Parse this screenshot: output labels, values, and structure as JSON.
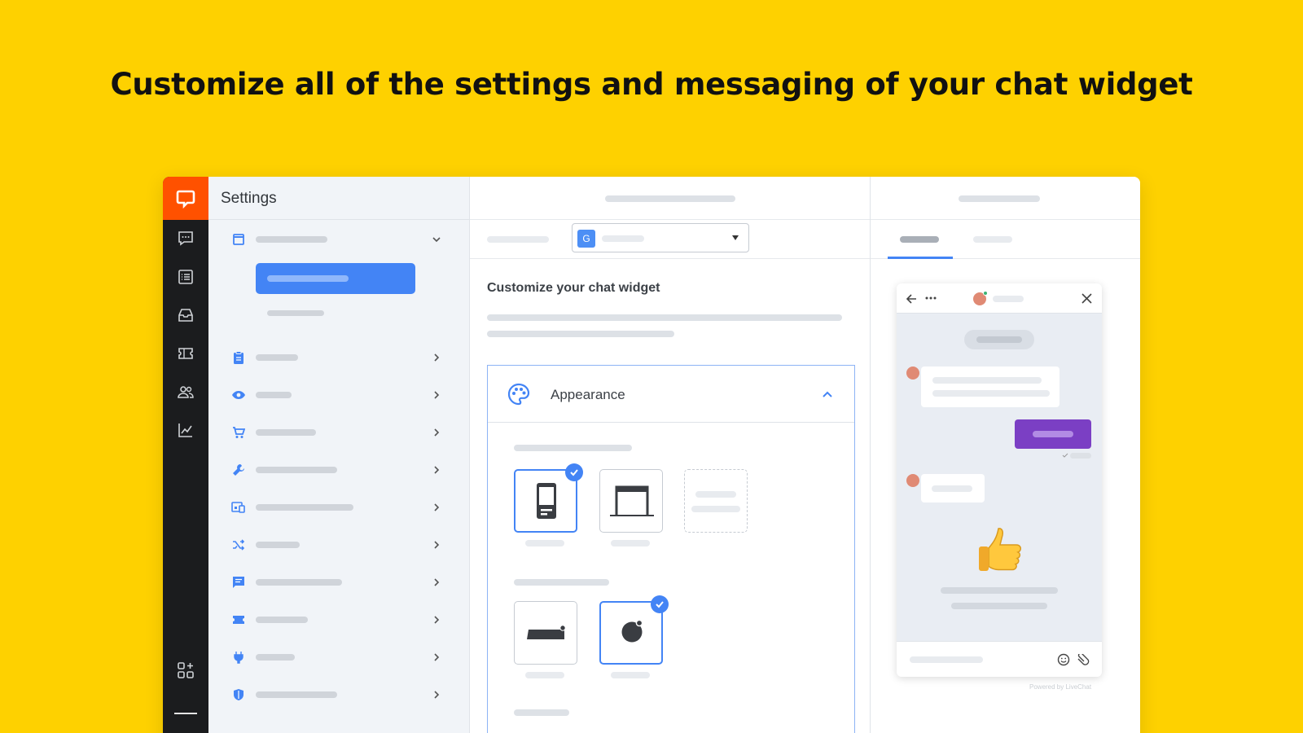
{
  "headline": "Customize all of the settings and messaging of your chat widget",
  "settings": {
    "title": "Settings"
  },
  "middle": {
    "title": "Customize your chat widget",
    "select_badge": "G",
    "section": {
      "title": "Appearance"
    }
  },
  "preview": {
    "powered_by": "Powered by LiveChat"
  },
  "colors": {
    "brand_orange": "#FF5100",
    "accent_blue": "#4384F5",
    "sent_purple": "#7B3FC4",
    "background_yellow": "#FED100"
  },
  "icons": [
    "chats-icon",
    "archives-icon",
    "inbox-icon",
    "tickets-icon",
    "customers-icon",
    "reports-icon",
    "apps-icon"
  ]
}
